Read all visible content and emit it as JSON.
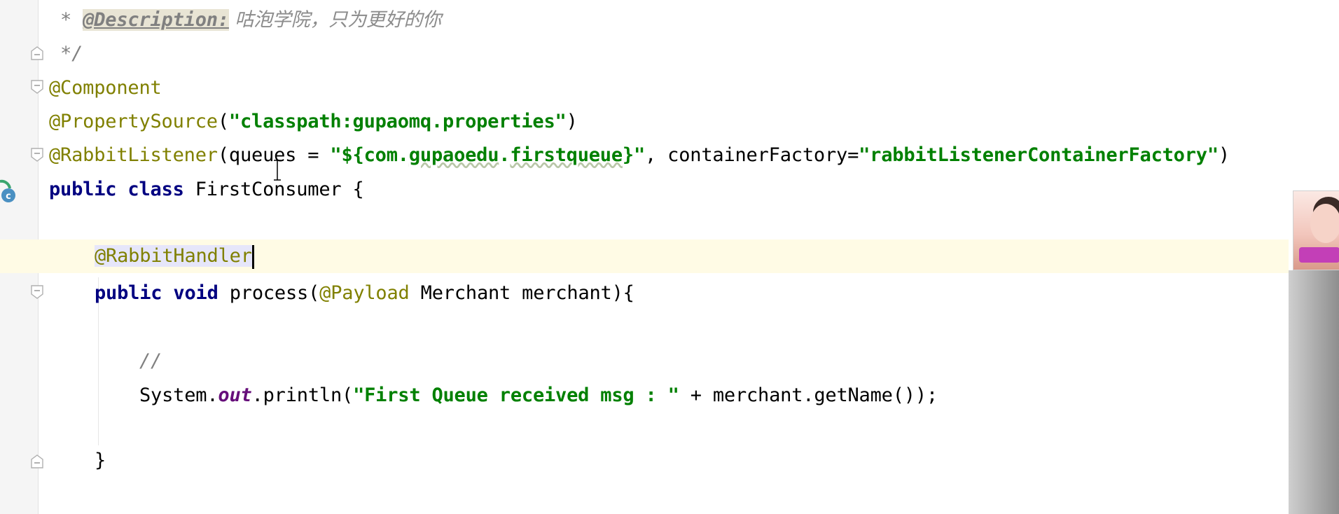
{
  "editor": {
    "lines": {
      "doc_desc": {
        "prefix": " * ",
        "tag": "@Description:",
        "text": " 咕泡学院，只为更好的你"
      },
      "doc_end": " */",
      "component": "@Component",
      "property_source": {
        "annotation": "@PropertySource",
        "open": "(",
        "value": "\"classpath:gupaomq.properties\"",
        "close": ")"
      },
      "rabbit_listener": {
        "annotation": "@RabbitListener",
        "open": "(",
        "param_queues": "queues",
        "eq1": " = ",
        "quote_open": "\"",
        "expr_dollar": "${",
        "expr_a": "com.",
        "expr_b": "gupaoedu",
        "expr_c": ".",
        "expr_d": "firstqueue",
        "expr_close": "}",
        "quote_close": "\"",
        "sep": ", ",
        "param_factory": "containerFactory",
        "eq2": "=",
        "factory_value": "\"rabbitListenerContainerFactory\"",
        "close": ")"
      },
      "class_decl": {
        "kw1": "public",
        "kw2": "class",
        "name": "FirstConsumer",
        "brace": " {"
      },
      "handler": "@RabbitHandler",
      "method_decl": {
        "kw1": "public",
        "kw2": "void",
        "name": "process",
        "open": "(",
        "anno": "@Payload",
        "param": " Merchant merchant",
        "close": "){"
      },
      "line_comment": "//",
      "println": {
        "obj": "System.",
        "field": "out",
        "call": ".println(",
        "str": "\"First Queue received msg : \"",
        "rest": " + merchant.getName());"
      },
      "method_close": "}"
    }
  },
  "icons": {
    "fold_markers": [
      "fold-end-icon",
      "fold-start-icon",
      "fold-start-icon",
      "fold-start-icon",
      "fold-end-icon"
    ],
    "class_gutter": "class-icon",
    "mouse": "text-cursor-icon"
  },
  "colors": {
    "annotation": "#808000",
    "string": "#008000",
    "keyword": "#000080",
    "comment": "#808080",
    "current_line": "#fffbe5",
    "static_field": "#660e7a"
  }
}
